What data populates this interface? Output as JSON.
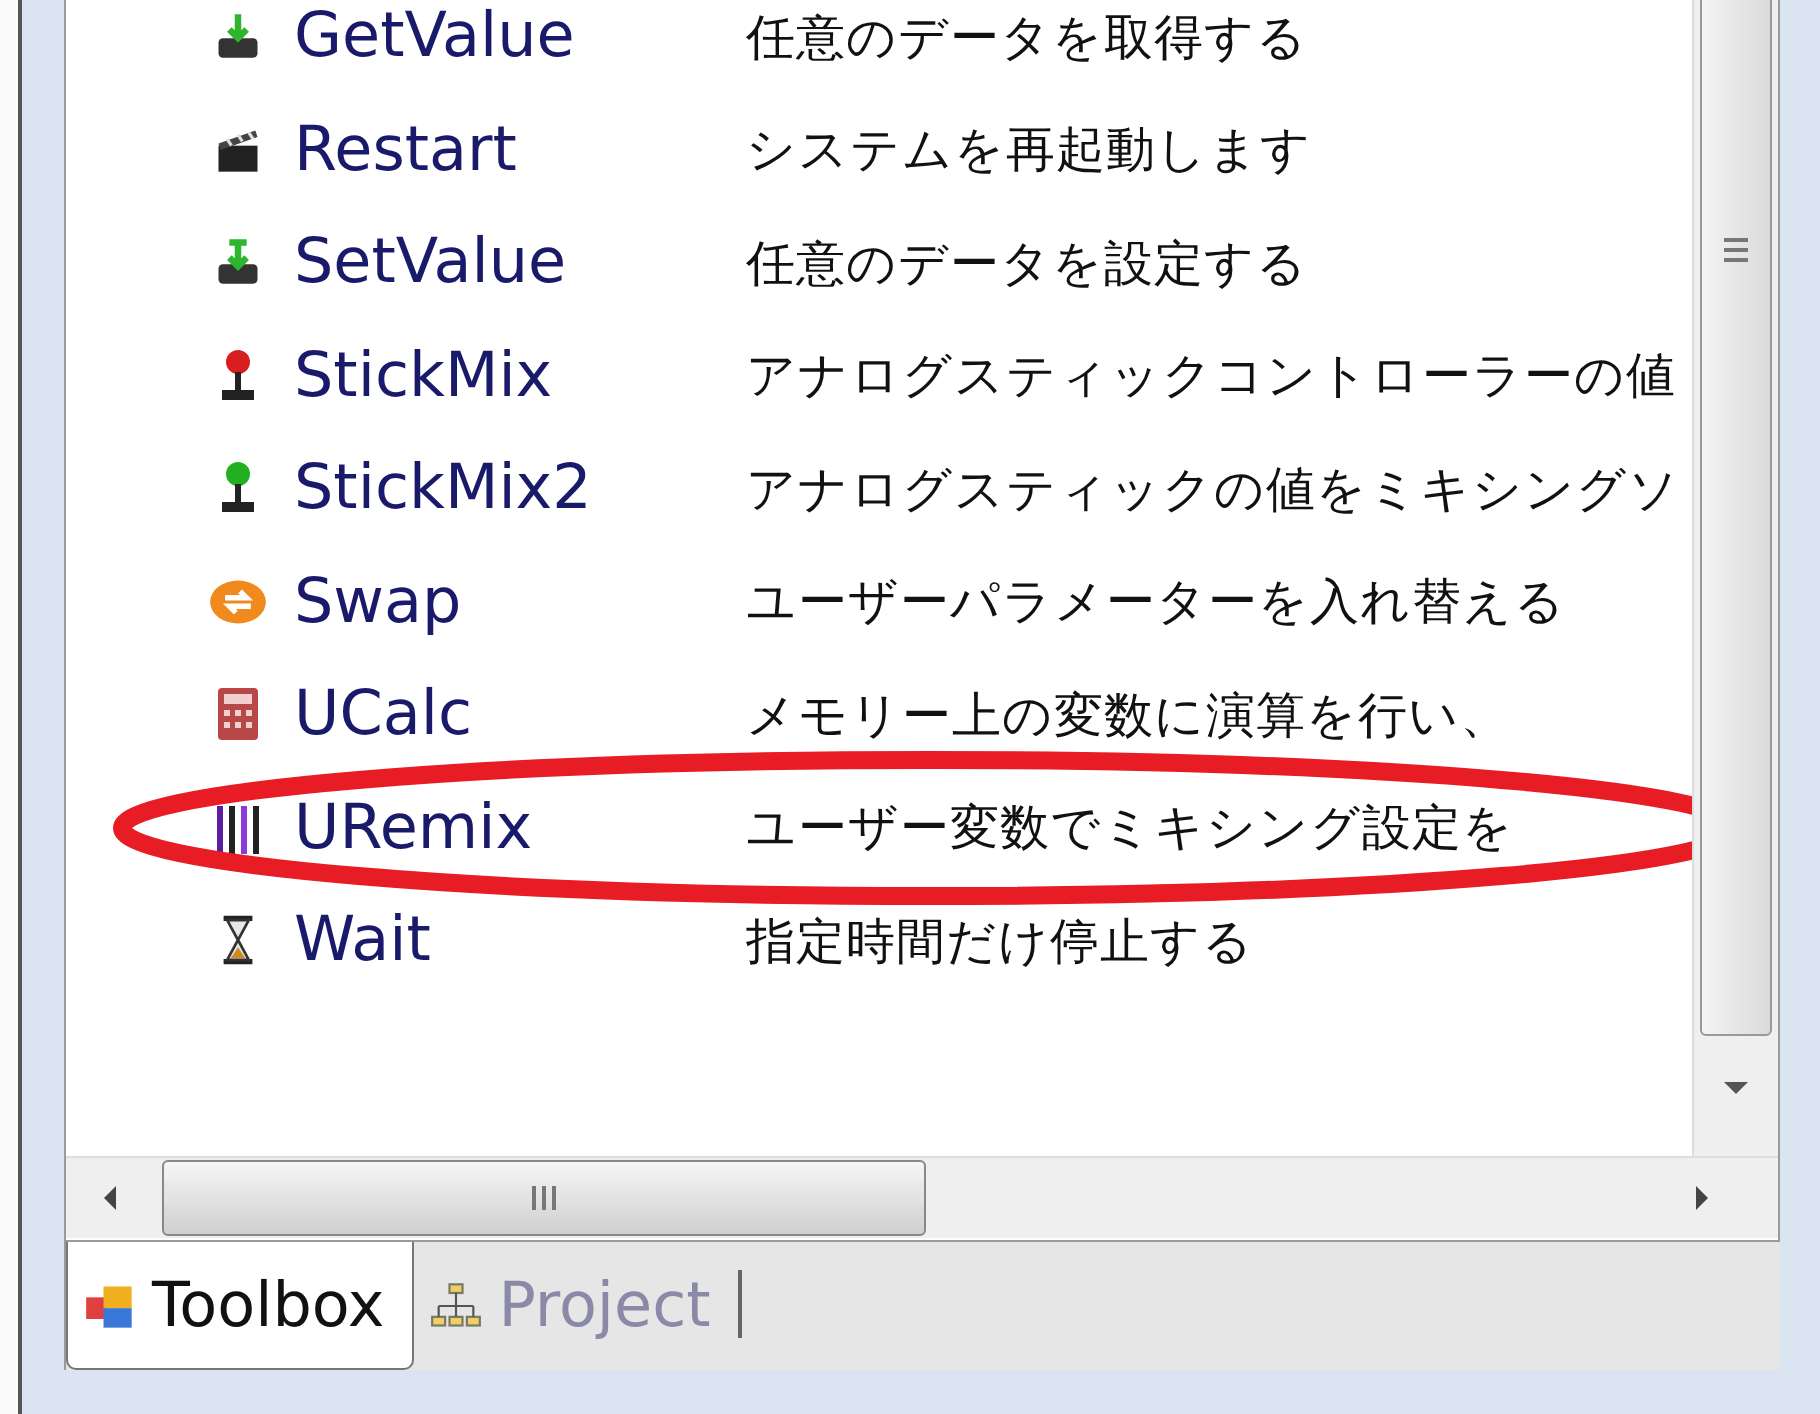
{
  "toolbox_list": {
    "rows": [
      {
        "kind": "download",
        "name": "GetValue",
        "description": "任意のデータを取得する"
      },
      {
        "kind": "clapper",
        "name": "Restart",
        "description": "システムを再起動します"
      },
      {
        "kind": "upload",
        "name": "SetValue",
        "description": "任意のデータを設定する"
      },
      {
        "kind": "joystick-red",
        "name": "StickMix",
        "description": "アナログスティックコントローラーの値"
      },
      {
        "kind": "joystick-green",
        "name": "StickMix2",
        "description": "アナログスティックの値をミキシングソ"
      },
      {
        "kind": "swap",
        "name": "Swap",
        "description": "ユーザーパラメーターを入れ替える"
      },
      {
        "kind": "calculator",
        "name": "UCalc",
        "description": "メモリー上の変数に演算を行い、"
      },
      {
        "kind": "bars",
        "name": "URemix",
        "description": "ユーザー変数でミキシング設定を"
      },
      {
        "kind": "hourglass",
        "name": "Wait",
        "description": "指定時間だけ停止する"
      }
    ]
  },
  "tabs": [
    {
      "kind": "toolbox",
      "label": "Toolbox",
      "selected": true
    },
    {
      "kind": "project",
      "label": "Project",
      "selected": false
    }
  ]
}
